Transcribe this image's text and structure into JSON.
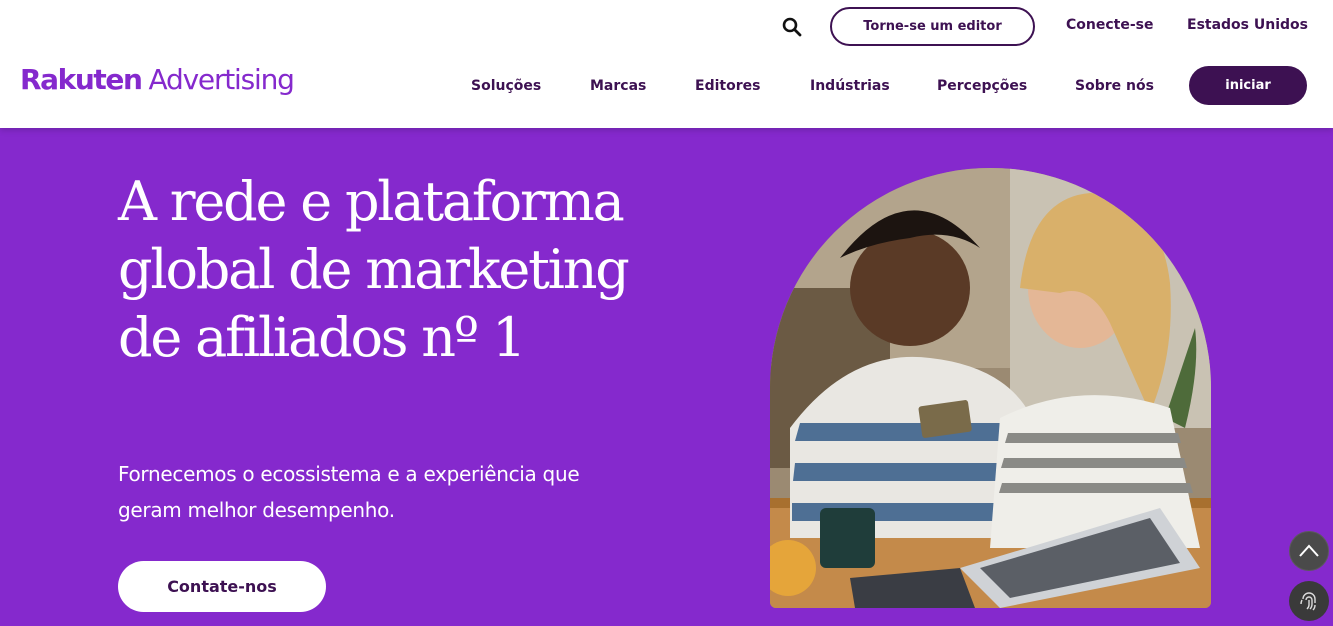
{
  "header": {
    "logo_brand": "Rakuten",
    "logo_product": "Advertising",
    "search_icon": "search-icon",
    "become_publisher_label": "Torne-se um editor",
    "connect_label": "Conecte-se",
    "region_label": "Estados Unidos",
    "start_label": "iniciar"
  },
  "nav": {
    "items": [
      {
        "label": "Soluções"
      },
      {
        "label": "Marcas"
      },
      {
        "label": "Editores"
      },
      {
        "label": "Indústrias"
      },
      {
        "label": "Percepções"
      },
      {
        "label": "Sobre nós"
      }
    ]
  },
  "hero": {
    "title": "A rede e plataforma global de marketing de afiliados nº 1",
    "subtitle": "Fornecemos o ecossistema e a experiência que geram melhor desempenho.",
    "contact_label": "Contate-nos",
    "image_icon": "hero-photo-couple-laptop"
  },
  "floating": {
    "scroll_top_icon": "chevron-up-icon",
    "privacy_icon": "fingerprint-icon"
  },
  "colors": {
    "brand_purple": "#8529cd",
    "dark_purple": "#3d1152",
    "white": "#ffffff"
  }
}
